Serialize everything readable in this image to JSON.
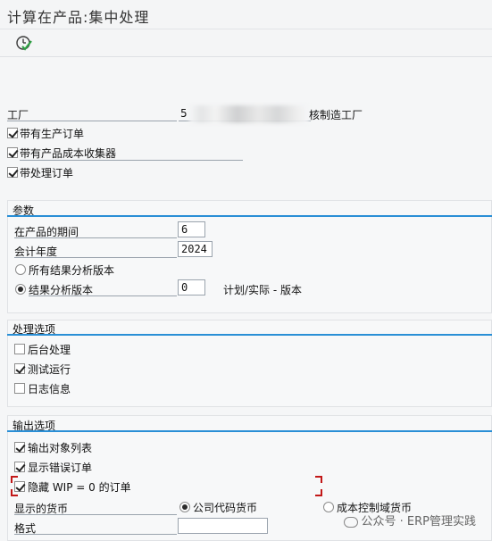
{
  "window": {
    "title": "计算在产品:集中处理"
  },
  "toolbar": {
    "execute_icon": "execute-clock-check-icon"
  },
  "header": {
    "plant": {
      "label": "工厂",
      "value": "5",
      "trailing": "核制造工厂"
    },
    "checkboxes": [
      {
        "label": "带有生产订单",
        "checked": true
      },
      {
        "label": "带有产品成本收集器",
        "checked": true
      },
      {
        "label": "带处理订单",
        "checked": true
      }
    ]
  },
  "params": {
    "title": "参数",
    "period": {
      "label": "在产品的期间",
      "value": "6"
    },
    "fiscal_year": {
      "label": "会计年度",
      "value": "2024"
    },
    "radio_all": {
      "label": "所有结果分析版本",
      "selected": false
    },
    "radio_version": {
      "label": "结果分析版本",
      "selected": true,
      "value": "0",
      "desc": "计划/实际 - 版本"
    }
  },
  "processing": {
    "title": "处理选项",
    "items": [
      {
        "label": "后台处理",
        "checked": false
      },
      {
        "label": "测试运行",
        "checked": true
      },
      {
        "label": "日志信息",
        "checked": false
      }
    ]
  },
  "output": {
    "title": "输出选项",
    "items": [
      {
        "label": "输出对象列表",
        "checked": true
      },
      {
        "label": "显示错误订单",
        "checked": true
      },
      {
        "label": "隐藏 WIP = 0 的订单",
        "checked": true
      }
    ],
    "currency_label": "显示的货币",
    "currency_company": {
      "label": "公司代码货币",
      "selected": true
    },
    "currency_coarea": {
      "label": "成本控制域货币",
      "selected": false
    },
    "format_label": "格式",
    "format_value": ""
  },
  "watermark": "公众号 · ERP管理实践",
  "colors": {
    "accent": "#2a8fd6",
    "highlight": "#c21818"
  }
}
